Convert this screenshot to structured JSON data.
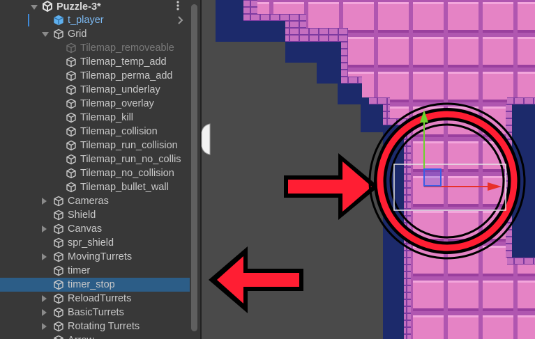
{
  "hierarchy": {
    "scene_name": "Puzzle-3*",
    "items": [
      {
        "label": "t_player",
        "style": "blue",
        "icon": "prefab-cube-icon"
      },
      {
        "label": "Grid",
        "style": "normal",
        "icon": "gameobject-cube-icon"
      },
      {
        "label": "Tilemap_removeable",
        "style": "dim",
        "icon": "gameobject-cube-icon"
      },
      {
        "label": "Tilemap_temp_add",
        "style": "normal",
        "icon": "gameobject-cube-icon"
      },
      {
        "label": "Tilemap_perma_add",
        "style": "normal",
        "icon": "gameobject-cube-icon"
      },
      {
        "label": "Tilemap_underlay",
        "style": "normal",
        "icon": "gameobject-cube-icon"
      },
      {
        "label": "Tilemap_overlay",
        "style": "normal",
        "icon": "gameobject-cube-icon"
      },
      {
        "label": "Tilemap_kill",
        "style": "normal",
        "icon": "gameobject-cube-icon"
      },
      {
        "label": "Tilemap_collision",
        "style": "normal",
        "icon": "gameobject-cube-icon"
      },
      {
        "label": "Tilemap_run_collision",
        "style": "normal",
        "icon": "gameobject-cube-icon"
      },
      {
        "label": "Tilemap_run_no_collis",
        "style": "normal",
        "icon": "gameobject-cube-icon"
      },
      {
        "label": "Tilemap_no_collision",
        "style": "normal",
        "icon": "gameobject-cube-icon"
      },
      {
        "label": "Tilemap_bullet_wall",
        "style": "normal",
        "icon": "gameobject-cube-icon"
      },
      {
        "label": "Cameras",
        "style": "normal",
        "icon": "gameobject-cube-icon"
      },
      {
        "label": "Shield",
        "style": "normal",
        "icon": "gameobject-cube-icon"
      },
      {
        "label": "Canvas",
        "style": "normal",
        "icon": "gameobject-cube-icon"
      },
      {
        "label": "spr_shield",
        "style": "normal",
        "icon": "gameobject-cube-icon"
      },
      {
        "label": "MovingTurrets",
        "style": "normal",
        "icon": "gameobject-cube-icon"
      },
      {
        "label": "timer",
        "style": "normal",
        "icon": "gameobject-cube-icon"
      },
      {
        "label": "timer_stop",
        "style": "normal",
        "icon": "gameobject-cube-icon",
        "selected": true
      },
      {
        "label": "ReloadTurrets",
        "style": "normal",
        "icon": "gameobject-cube-icon"
      },
      {
        "label": "BasicTurrets",
        "style": "normal",
        "icon": "gameobject-cube-icon"
      },
      {
        "label": "Rotating Turrets",
        "style": "normal",
        "icon": "gameobject-cube-icon"
      },
      {
        "label": "Arrow",
        "style": "normal",
        "icon": "gameobject-cube-icon"
      }
    ]
  },
  "colors": {
    "selection": "#2c5d87",
    "tile_pink": "#e583c5",
    "tile_border": "#b056b0",
    "void_blue": "#1c2a6b",
    "arrow_red": "#ff1e33",
    "gizmo_x": "#e8302a",
    "gizmo_y": "#6ed12e",
    "gizmo_z": "#3a5ee6"
  }
}
